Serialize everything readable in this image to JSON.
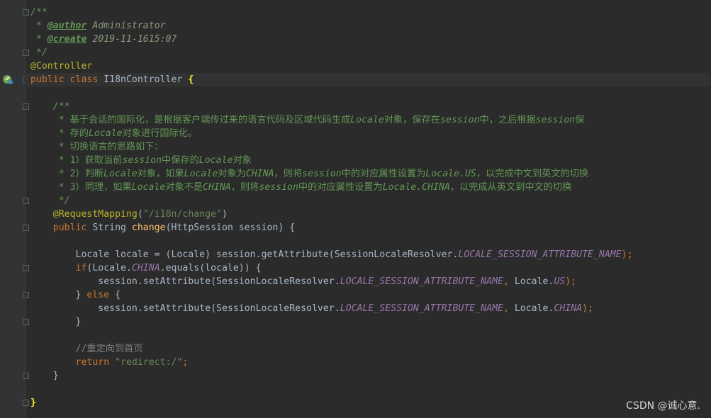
{
  "colors": {
    "background": "#2b2b2b",
    "gutter": "#313335",
    "default_text": "#a9b7c6",
    "doc_comment": "#629755",
    "doc_tag": "#629755",
    "keyword": "#cc7832",
    "annotation": "#bbb529",
    "string": "#6a8759",
    "static_field": "#9876aa",
    "method_decl": "#ffc66d",
    "line_comment": "#808080"
  },
  "gutter_icon": "spring-bean-icon",
  "editor": {
    "lines": [
      {
        "tokens": [
          {
            "text": "/**",
            "c": "#629755",
            "i": true
          }
        ]
      },
      {
        "tokens": [
          {
            "text": " * ",
            "c": "#629755",
            "i": true
          },
          {
            "text": "@author",
            "c": "#629755",
            "i": true,
            "b": true,
            "u": true
          },
          {
            "text": " Administrator",
            "c": "#8a9a7e",
            "i": true
          }
        ]
      },
      {
        "tokens": [
          {
            "text": " * ",
            "c": "#629755",
            "i": true
          },
          {
            "text": "@create",
            "c": "#629755",
            "i": true,
            "b": true,
            "u": true
          },
          {
            "text": " 2019-11-1615:07",
            "c": "#8a9a7e",
            "i": true
          }
        ]
      },
      {
        "tokens": [
          {
            "text": " */",
            "c": "#629755",
            "i": true
          }
        ]
      },
      {
        "tokens": [
          {
            "text": "@Controller",
            "c": "#bbb529"
          }
        ]
      },
      {
        "current": true,
        "tokens": [
          {
            "text": "public class ",
            "c": "#cc7832"
          },
          {
            "text": "I18nController ",
            "c": "#a9b7c6"
          },
          {
            "text": "{",
            "c": "#ffef28",
            "b": true
          }
        ]
      },
      {
        "tokens": []
      },
      {
        "tokens": [
          {
            "text": "    /**",
            "c": "#629755",
            "i": true
          }
        ]
      },
      {
        "tokens": [
          {
            "text": "     * 基于会话的国际化，是根据客户端传过来的语言代码及区域代码生成",
            "c": "#629755"
          },
          {
            "text": "Locale",
            "c": "#629755",
            "i": true
          },
          {
            "text": "对象，保存在",
            "c": "#629755"
          },
          {
            "text": "session",
            "c": "#629755",
            "i": true
          },
          {
            "text": "中，之后根据",
            "c": "#629755"
          },
          {
            "text": "session",
            "c": "#629755",
            "i": true
          },
          {
            "text": "保",
            "c": "#629755"
          }
        ]
      },
      {
        "tokens": [
          {
            "text": "     * 存的",
            "c": "#629755"
          },
          {
            "text": "Locale",
            "c": "#629755",
            "i": true
          },
          {
            "text": "对象进行国际化。",
            "c": "#629755"
          }
        ]
      },
      {
        "tokens": [
          {
            "text": "     * 切换语言的思路如下：",
            "c": "#629755"
          }
        ]
      },
      {
        "tokens": [
          {
            "text": "     * 1）获取当前",
            "c": "#629755"
          },
          {
            "text": "session",
            "c": "#629755",
            "i": true
          },
          {
            "text": "中保存的",
            "c": "#629755"
          },
          {
            "text": "Locale",
            "c": "#629755",
            "i": true
          },
          {
            "text": "对象",
            "c": "#629755"
          }
        ]
      },
      {
        "tokens": [
          {
            "text": "     * 2）判断",
            "c": "#629755"
          },
          {
            "text": "Locale",
            "c": "#629755",
            "i": true
          },
          {
            "text": "对象，如果",
            "c": "#629755"
          },
          {
            "text": "Locale",
            "c": "#629755",
            "i": true
          },
          {
            "text": "对象为",
            "c": "#629755"
          },
          {
            "text": "CHINA",
            "c": "#629755",
            "i": true
          },
          {
            "text": "，则将",
            "c": "#629755"
          },
          {
            "text": "session",
            "c": "#629755",
            "i": true
          },
          {
            "text": "中的对应属性设置为",
            "c": "#629755"
          },
          {
            "text": "Locale.US",
            "c": "#629755",
            "i": true
          },
          {
            "text": "，以完成中文到英文的切换",
            "c": "#629755"
          }
        ]
      },
      {
        "tokens": [
          {
            "text": "     * 3）同理，如果",
            "c": "#629755"
          },
          {
            "text": "Locale",
            "c": "#629755",
            "i": true
          },
          {
            "text": "对象不是",
            "c": "#629755"
          },
          {
            "text": "CHINA",
            "c": "#629755",
            "i": true
          },
          {
            "text": "，则将",
            "c": "#629755"
          },
          {
            "text": "session",
            "c": "#629755",
            "i": true
          },
          {
            "text": "中的对应属性设置为",
            "c": "#629755"
          },
          {
            "text": "Locale.CHINA",
            "c": "#629755",
            "i": true
          },
          {
            "text": "，以完成从英文到中文的切换",
            "c": "#629755"
          }
        ]
      },
      {
        "tokens": [
          {
            "text": "     */",
            "c": "#629755",
            "i": true
          }
        ]
      },
      {
        "tokens": [
          {
            "text": "    @RequestMapping",
            "c": "#bbb529"
          },
          {
            "text": "(",
            "c": "#a9b7c6"
          },
          {
            "text": "\"/i18n/change\"",
            "c": "#6a8759"
          },
          {
            "text": ")",
            "c": "#a9b7c6"
          }
        ]
      },
      {
        "tokens": [
          {
            "text": "    public ",
            "c": "#cc7832"
          },
          {
            "text": "String ",
            "c": "#a9b7c6"
          },
          {
            "text": "change",
            "c": "#ffc66d"
          },
          {
            "text": "(HttpSession session) {",
            "c": "#a9b7c6"
          }
        ]
      },
      {
        "tokens": []
      },
      {
        "tokens": [
          {
            "text": "        Locale locale = (Locale) session.getAttribute(SessionLocaleResolver.",
            "c": "#a9b7c6"
          },
          {
            "text": "LOCALE_SESSION_ATTRIBUTE_NAME",
            "c": "#9876aa",
            "i": true
          },
          {
            "text": ");",
            "c": "#cc7832"
          }
        ]
      },
      {
        "tokens": [
          {
            "text": "        if",
            "c": "#cc7832"
          },
          {
            "text": "(Locale.",
            "c": "#a9b7c6"
          },
          {
            "text": "CHINA",
            "c": "#9876aa",
            "i": true
          },
          {
            "text": ".equals(locale)) {",
            "c": "#a9b7c6"
          }
        ]
      },
      {
        "tokens": [
          {
            "text": "            session.setAttribute(SessionLocaleResolver.",
            "c": "#a9b7c6"
          },
          {
            "text": "LOCALE_SESSION_ATTRIBUTE_NAME",
            "c": "#9876aa",
            "i": true
          },
          {
            "text": ", ",
            "c": "#cc7832"
          },
          {
            "text": "Locale.",
            "c": "#a9b7c6"
          },
          {
            "text": "US",
            "c": "#9876aa",
            "i": true
          },
          {
            "text": ");",
            "c": "#cc7832"
          }
        ]
      },
      {
        "tokens": [
          {
            "text": "        } ",
            "c": "#a9b7c6"
          },
          {
            "text": "else ",
            "c": "#cc7832"
          },
          {
            "text": "{",
            "c": "#a9b7c6"
          }
        ]
      },
      {
        "tokens": [
          {
            "text": "            session.setAttribute(SessionLocaleResolver.",
            "c": "#a9b7c6"
          },
          {
            "text": "LOCALE_SESSION_ATTRIBUTE_NAME",
            "c": "#9876aa",
            "i": true
          },
          {
            "text": ", ",
            "c": "#cc7832"
          },
          {
            "text": "Locale.",
            "c": "#a9b7c6"
          },
          {
            "text": "CHINA",
            "c": "#9876aa",
            "i": true
          },
          {
            "text": ");",
            "c": "#cc7832"
          }
        ]
      },
      {
        "tokens": [
          {
            "text": "        }",
            "c": "#a9b7c6"
          }
        ]
      },
      {
        "tokens": []
      },
      {
        "tokens": [
          {
            "text": "        //重定向到首页",
            "c": "#808080"
          }
        ]
      },
      {
        "tokens": [
          {
            "text": "        return ",
            "c": "#cc7832"
          },
          {
            "text": "\"redirect:/\"",
            "c": "#6a8759"
          },
          {
            "text": ";",
            "c": "#cc7832"
          }
        ]
      },
      {
        "tokens": [
          {
            "text": "    }",
            "c": "#a9b7c6"
          }
        ]
      },
      {
        "tokens": []
      },
      {
        "tokens": [
          {
            "text": "}",
            "c": "#ffef28",
            "b": true
          }
        ]
      }
    ]
  },
  "watermark": "CSDN @诚心意."
}
